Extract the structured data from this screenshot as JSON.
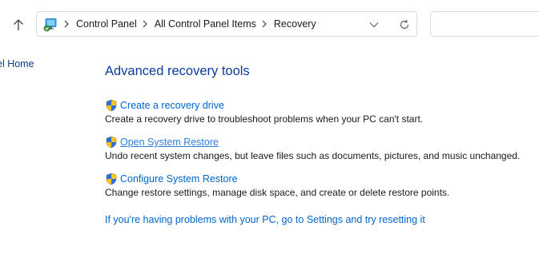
{
  "nav": {
    "breadcrumbs": [
      "Control Panel",
      "All Control Panel Items",
      "Recovery"
    ],
    "up_icon": "arrow-up-icon",
    "location_icon": "control-panel-icon",
    "dropdown_icon": "chevron-down-icon",
    "refresh_icon": "refresh-icon",
    "search_placeholder": ""
  },
  "sidebar": {
    "home_link": "el Home"
  },
  "main": {
    "heading": "Advanced recovery tools",
    "items": [
      {
        "label": "Create a recovery drive",
        "description": "Create a recovery drive to troubleshoot problems when your PC can't start.",
        "icon": "uac-shield-icon"
      },
      {
        "label": "Open System Restore",
        "description": "Undo recent system changes, but leave files such as documents, pictures, and music unchanged.",
        "icon": "uac-shield-icon"
      },
      {
        "label": "Configure System Restore",
        "description": "Change restore settings, manage disk space, and create or delete restore points.",
        "icon": "uac-shield-icon"
      }
    ],
    "reset_link": "If you're having problems with your PC, go to Settings and try resetting it"
  },
  "colors": {
    "heading": "#0b3c9c",
    "link": "#0066cc",
    "link_hover": "#2f7fd6",
    "text": "#1a1a1a",
    "border": "#d9d9d9"
  }
}
